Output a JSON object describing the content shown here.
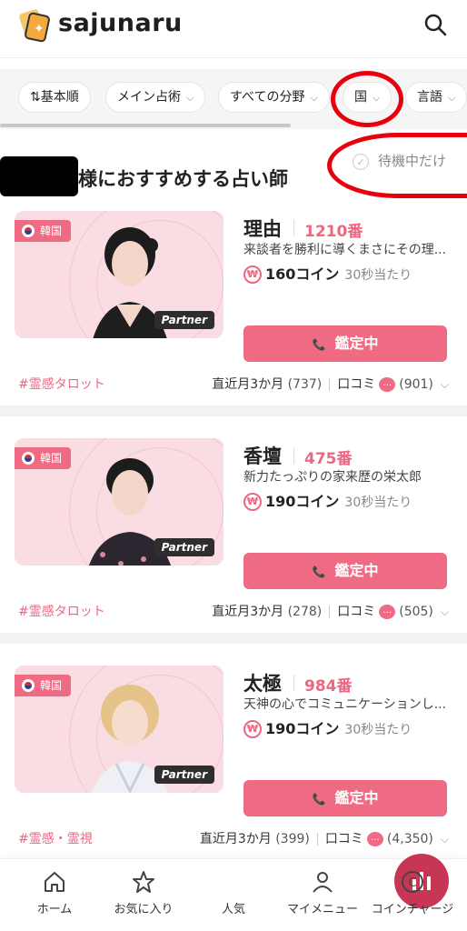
{
  "header": {
    "brand": "sajunaru"
  },
  "filters": [
    {
      "label": "基本順",
      "prefix": "⇅"
    },
    {
      "label": "メイン占術"
    },
    {
      "label": "すべての分野"
    },
    {
      "label": "国"
    },
    {
      "label": "言語"
    }
  ],
  "section": {
    "title": "様におすすめする占い師",
    "waiting_label": "待機中だけ"
  },
  "cards": [
    {
      "country": "韓国",
      "partner": "Partner",
      "name": "理由",
      "rank": "1210番",
      "desc": "来談者を勝利に導くまさにその理...",
      "price": "160コイン",
      "per": "30秒当たり",
      "button": "鑑定中",
      "genre": "#霊感タロット",
      "recent": "直近月3か月",
      "recent_count": "(737)",
      "reviews": "口コミ",
      "review_count": "(901)"
    },
    {
      "country": "韓国",
      "partner": "Partner",
      "name": "香壇",
      "rank": "475番",
      "desc": "新力たっぷりの家来歴の栄太郎",
      "price": "190コイン",
      "per": "30秒当たり",
      "button": "鑑定中",
      "genre": "#霊感タロット",
      "recent": "直近月3か月",
      "recent_count": "(278)",
      "reviews": "口コミ",
      "review_count": "(505)"
    },
    {
      "country": "韓国",
      "partner": "Partner",
      "name": "太極",
      "rank": "984番",
      "desc": "天神の心でコミュニケーションし...",
      "price": "190コイン",
      "per": "30秒当たり",
      "button": "鑑定中",
      "genre": "#霊感・霊視",
      "recent": "直近月3か月",
      "recent_count": "(399)",
      "reviews": "口コミ",
      "review_count": "(4,350)"
    }
  ],
  "tabs": [
    {
      "label": "ホーム",
      "icon": "home-icon"
    },
    {
      "label": "お気に入り",
      "icon": "star-icon"
    },
    {
      "label": "人気",
      "icon": "chart-icon"
    },
    {
      "label": "マイメニュー",
      "icon": "person-icon"
    },
    {
      "label": "コインチャージ",
      "icon": "coin-icon"
    }
  ],
  "colors": {
    "accent": "#ef6b84",
    "rank": "#ec6782",
    "annotation": "#e8000f"
  }
}
